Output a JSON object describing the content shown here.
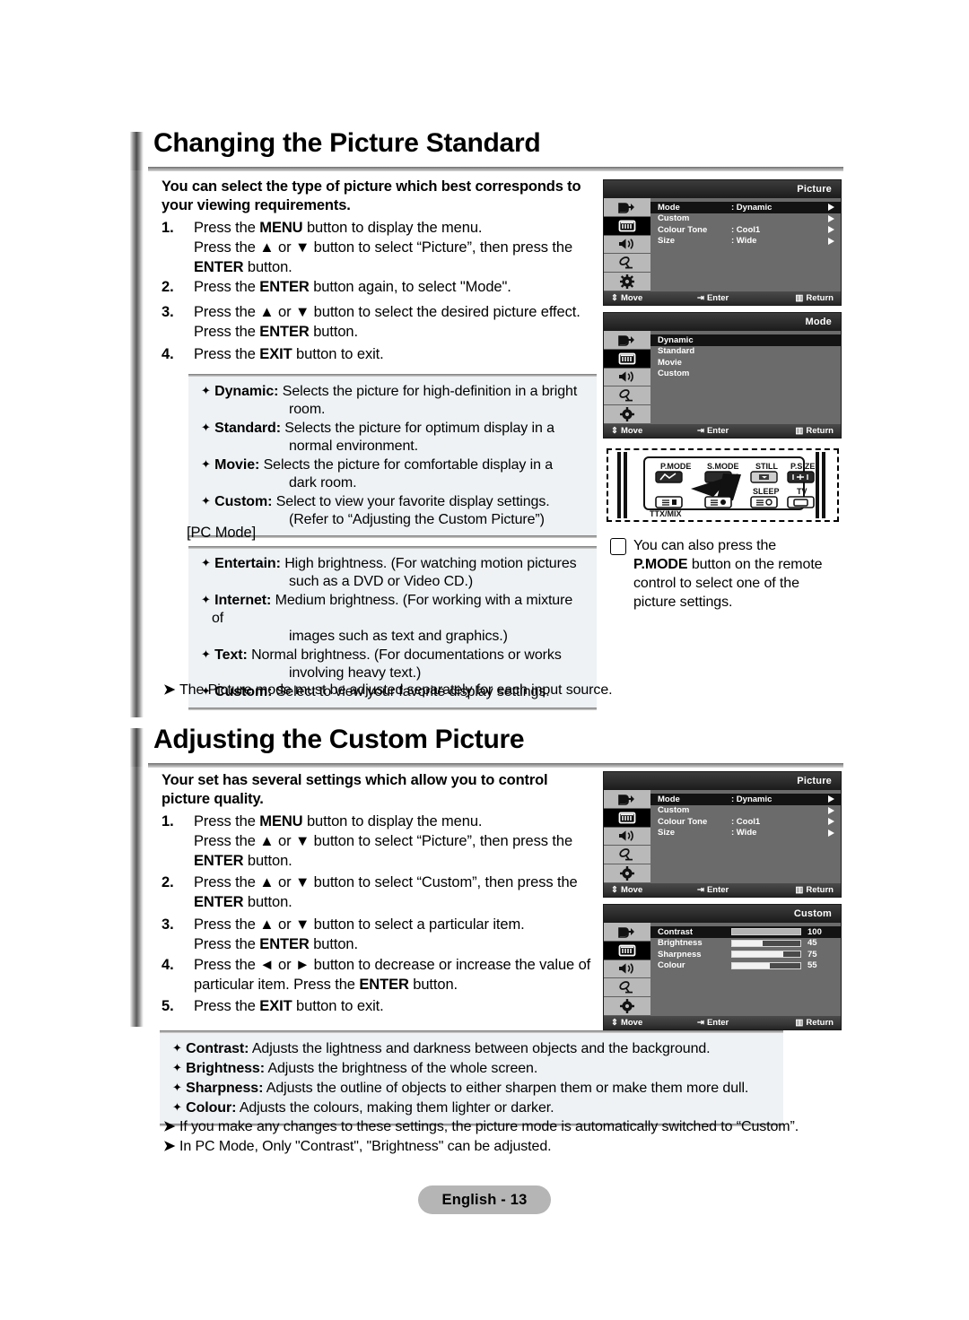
{
  "sections": [
    {
      "title": "Changing the Picture Standard",
      "lead": "You can select the type of picture which best corresponds to your viewing requirements.",
      "steps": [
        {
          "num": "1.",
          "html": "Press the <b>MENU</b> button to display the menu.<br>Press the ▲ or ▼ button to select “Picture”, then press the<br><b>ENTER</b> button."
        },
        {
          "num": "2.",
          "html": "Press the <b>ENTER</b> button again, to select \"Mode\"."
        },
        {
          "num": "3.",
          "html": "Press the ▲ or ▼ button to select the desired picture effect.<br>Press the <b>ENTER</b> button."
        },
        {
          "num": "4.",
          "html": "Press the <b>EXIT</b> button to exit."
        }
      ],
      "infobox": [
        {
          "term": "Dynamic:",
          "desc": "Selects the picture for high-definition in a bright",
          "cont": "room."
        },
        {
          "term": "Standard:",
          "desc": "Selects the picture for optimum display in a",
          "cont": "normal environment."
        },
        {
          "term": "Movie:",
          "desc": "Selects the picture for comfortable display in a",
          "cont": "dark room."
        },
        {
          "term": "Custom:",
          "desc": "Select to view your favorite display settings.",
          "cont": "(Refer to “Adjusting the Custom Picture”)"
        }
      ],
      "pc_mode_label": "[PC Mode]",
      "pc_infobox": [
        {
          "term": "Entertain:",
          "desc": "High brightness. (For watching motion pictures",
          "cont": "such as a DVD or Video CD.)"
        },
        {
          "term": "Internet:",
          "desc": "Medium brightness. (For working with a mixture of",
          "cont": "images such as text and graphics.)"
        },
        {
          "term": "Text:",
          "desc": "Normal brightness. (For documentations or works",
          "cont": "involving heavy text.)"
        },
        {
          "term": "Custom:",
          "desc": "Select to view your favorite display settings.",
          "cont": ""
        }
      ],
      "notes": [
        "The Picture mode must be adjusted separately for each input source."
      ]
    },
    {
      "title": "Adjusting the Custom Picture",
      "lead": "Your set has several settings which allow you to control picture quality.",
      "steps": [
        {
          "num": "1.",
          "html": "Press the <b>MENU</b> button to display the menu.<br>Press the ▲ or ▼ button to select “Picture”, then press the<br><b>ENTER</b> button."
        },
        {
          "num": "2.",
          "html": "Press the ▲ or ▼ button to select “Custom”, then press the<br><b>ENTER</b> button."
        },
        {
          "num": "3.",
          "html": "Press the ▲ or ▼ button to select a particular item.<br>Press the <b>ENTER</b> button."
        },
        {
          "num": "4.",
          "html": "Press the ◄ or ► button to decrease or increase the value of<br>particular item. Press the <b>ENTER</b> button."
        },
        {
          "num": "5.",
          "html": "Press the <b>EXIT</b> button to exit."
        }
      ],
      "infobox": [
        {
          "term": "Contrast:",
          "desc": "Adjusts the lightness and darkness between objects and the background.",
          "cont": ""
        },
        {
          "term": "Brightness:",
          "desc": "Adjusts the brightness of the whole screen.",
          "cont": ""
        },
        {
          "term": "Sharpness:",
          "desc": "Adjusts the outline of objects to either sharpen them or make them more dull.",
          "cont": ""
        },
        {
          "term": "Colour:",
          "desc": "Adjusts the colours, making them lighter or darker.",
          "cont": ""
        }
      ],
      "notes": [
        "If you make any changes to these settings, the picture mode is automatically switched to “Custom”.",
        "In PC Mode, Only \"Contrast\", \"Brightness\" can be adjusted."
      ]
    }
  ],
  "osd": {
    "footer": {
      "move": "Move",
      "enter": "Enter",
      "return": "Return"
    },
    "rail_icons": [
      "source-icon",
      "picture-icon",
      "sound-icon",
      "channel-icon",
      "setup-icon"
    ],
    "selected_rail_index": 1,
    "picture_menu": {
      "title": "Picture",
      "rows": [
        {
          "label": "Mode",
          "value": ": Dynamic",
          "highlight": true,
          "caret": true
        },
        {
          "label": "Custom",
          "value": "",
          "highlight": false,
          "caret": true
        },
        {
          "label": "Colour Tone",
          "value": ": Cool1",
          "highlight": false,
          "caret": true
        },
        {
          "label": "Size",
          "value": ": Wide",
          "highlight": false,
          "caret": true
        }
      ]
    },
    "mode_menu": {
      "title": "Mode",
      "rows": [
        {
          "label": "Dynamic",
          "highlight": true
        },
        {
          "label": "Standard",
          "highlight": false
        },
        {
          "label": "Movie",
          "highlight": false
        },
        {
          "label": "Custom",
          "highlight": false
        }
      ]
    },
    "custom_menu": {
      "title": "Custom",
      "rows": [
        {
          "label": "Contrast",
          "amount": "100",
          "percent": 100,
          "highlight": true
        },
        {
          "label": "Brightness",
          "amount": "45",
          "percent": 45,
          "highlight": false
        },
        {
          "label": "Sharpness",
          "amount": "75",
          "percent": 75,
          "highlight": false
        },
        {
          "label": "Colour",
          "amount": "55",
          "percent": 55,
          "highlight": false
        }
      ]
    }
  },
  "remote": {
    "buttons": [
      {
        "label": "P.MODE",
        "glyph": "pmode-icon"
      },
      {
        "label": "S.MODE",
        "glyph": "smode-icon"
      },
      {
        "label": "STILL",
        "glyph": "still-icon"
      },
      {
        "label": "P.SIZE",
        "glyph": "psize-icon"
      },
      {
        "label": "SLEEP",
        "glyph": "sleep-icon"
      },
      {
        "label": "TV",
        "glyph": "tv-icon"
      },
      {
        "label": "TTX/MIX",
        "glyph": "ttxmix-icon"
      }
    ]
  },
  "hand_note": {
    "text_html": "You can also press the<br><b>P.MODE</b> button on the remote<br>control to select one of the<br>picture settings."
  },
  "footer": {
    "page_label": "English - 13"
  }
}
